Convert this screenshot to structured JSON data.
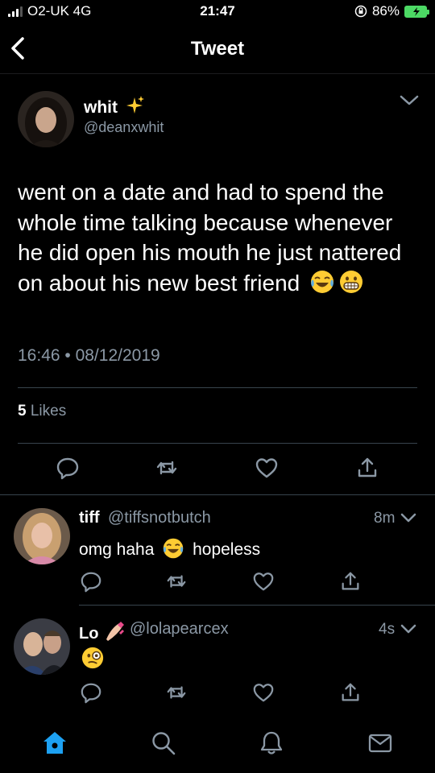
{
  "status_bar": {
    "carrier": "O2-UK 4G",
    "time": "21:47",
    "battery": "86%"
  },
  "header": {
    "title": "Tweet"
  },
  "tweet": {
    "author_name": "whit",
    "author_handle": "@deanxwhit",
    "text": "went on a date and had to spend the whole time talking because whenever he did open his mouth he just nattered on about his new best friend",
    "timestamp": "16:46 • 08/12/2019",
    "likes_count": "5",
    "likes_label": "Likes"
  },
  "replies": [
    {
      "name": "tiff",
      "handle": "@tiffsnotbutch",
      "time": "8m",
      "text_before": "omg haha",
      "text_after": "hopeless"
    },
    {
      "name": "Lo",
      "handle": "@lolapearcex",
      "time": "4s",
      "text_before": "",
      "text_after": ""
    }
  ],
  "icons": {
    "reply": "reply-icon",
    "retweet": "retweet-icon",
    "like": "heart-icon",
    "share": "share-icon",
    "home": "home-icon",
    "search": "search-icon",
    "notifications": "bell-icon",
    "messages": "mail-icon"
  },
  "colors": {
    "background": "#000000",
    "secondary_text": "#8b98a5",
    "accent": "#1da1f2",
    "battery": "#4cd964"
  }
}
